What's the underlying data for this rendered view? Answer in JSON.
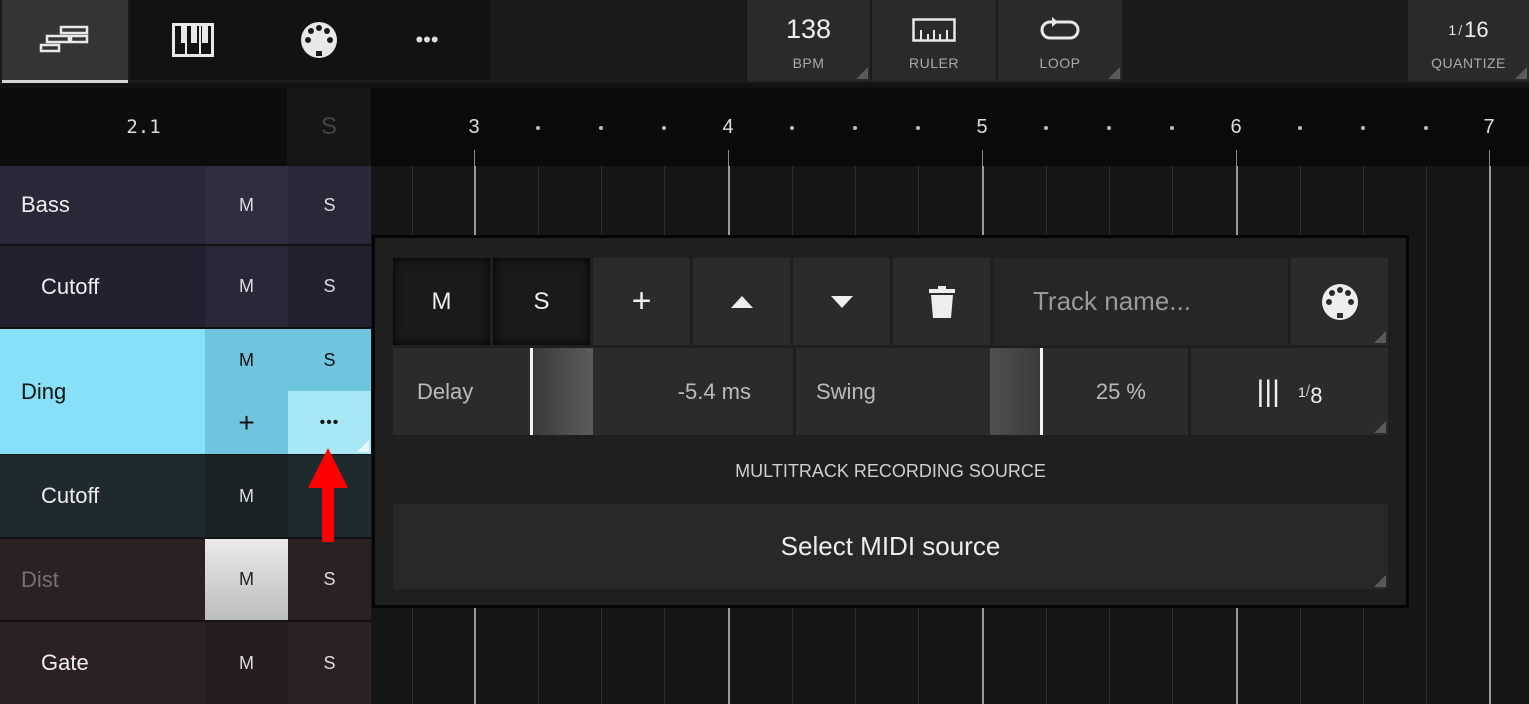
{
  "toolbar": {
    "tabs": [
      {
        "name": "tracks",
        "icon": "tracks-icon",
        "active": true
      },
      {
        "name": "piano-roll",
        "icon": "piano-icon",
        "active": false
      },
      {
        "name": "midi",
        "icon": "midi-port-icon",
        "active": false
      },
      {
        "name": "more",
        "icon": "more-icon",
        "active": false
      }
    ],
    "more_label": "•••",
    "bpm_value": "138",
    "bpm_label": "BPM",
    "ruler_label": "RULER",
    "loop_label": "LOOP",
    "quantize_num": "1",
    "quantize_den": "16",
    "quantize_label": "QUANTIZE"
  },
  "transport": {
    "position": "2.1",
    "solo_header": "S"
  },
  "ruler": {
    "bars": [
      "3",
      "4",
      "5",
      "6",
      "7"
    ]
  },
  "tracks": [
    {
      "name": "Bass",
      "m": "M",
      "s": "S",
      "color": "#2a2838"
    },
    {
      "name": "Cutoff",
      "m": "M",
      "s": "S",
      "color": "#232030"
    },
    {
      "name": "Ding",
      "m": "M",
      "s": "S",
      "add": "+",
      "more": "•••",
      "color": "#86e0f8"
    },
    {
      "name": "Cutoff",
      "m": "M",
      "s": "",
      "color": "#1e2a2e"
    },
    {
      "name": "Dist",
      "m": "M",
      "s": "S",
      "color": "#2b2125"
    },
    {
      "name": "Gate",
      "m": "M",
      "s": "S",
      "color": "#2b2125"
    }
  ],
  "popup": {
    "mute_label": "M",
    "solo_label": "S",
    "add_label": "+",
    "track_name_placeholder": "Track name...",
    "delay_label": "Delay",
    "delay_value": "-5.4 ms",
    "swing_label": "Swing",
    "swing_value": "25 %",
    "swing_fraction": 0.25,
    "division_num": "1",
    "division_den": "8",
    "section_title": "MULTITRACK RECORDING SOURCE",
    "midi_source_label": "Select MIDI source"
  },
  "colors": {
    "accent_selected_track": "#86e0f8",
    "annotation_arrow": "#ff0000"
  }
}
